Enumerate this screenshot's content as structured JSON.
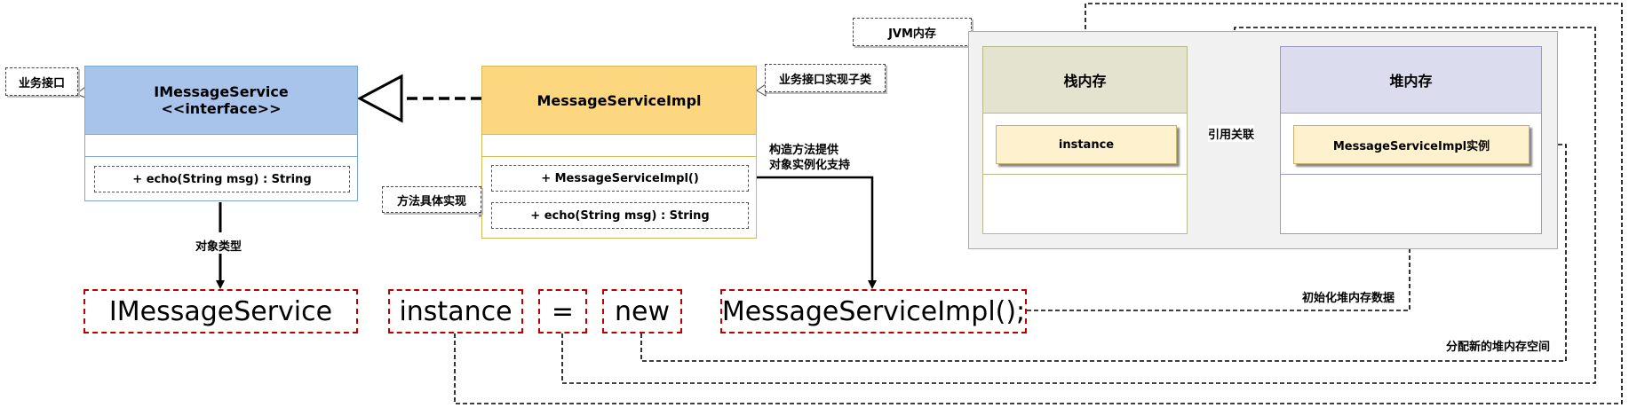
{
  "interface_class": {
    "name": "IMessageService",
    "stereotype": "<<interface>>",
    "method": "+ echo(String msg) : String",
    "note": "业务接口",
    "colors": {
      "header": "#a9c4eb",
      "border": "#7ea6d9"
    }
  },
  "impl_class": {
    "name": "MessageServiceImpl",
    "methods": [
      "+ MessageServiceImpl()",
      "+ echo(String msg) : String"
    ],
    "note": "业务接口实现子类",
    "colors": {
      "header": "#fcd77f",
      "border": "#d6b656"
    }
  },
  "notes": {
    "method_impl": "方法具体实现",
    "constructor": [
      "构造方法提供",
      "对象实例化支持"
    ],
    "object_type": "对象类型"
  },
  "code_tokens": [
    "IMessageService",
    "instance",
    "=",
    "new",
    "MessageServiceImpl();"
  ],
  "memory": {
    "title": "JVM内存",
    "stack": {
      "title": "栈内存",
      "cell": "instance"
    },
    "heap": {
      "title": "堆内存",
      "cell": "MessageServiceImpl实例"
    },
    "reference_label": "引用关联",
    "init_label": "初始化堆内存数据",
    "alloc_label": "分配新的堆内存空间",
    "colors": {
      "stack_header": "#e3e3cf",
      "heap_header": "#dcdcef",
      "cell": "#fdf2cd"
    }
  }
}
